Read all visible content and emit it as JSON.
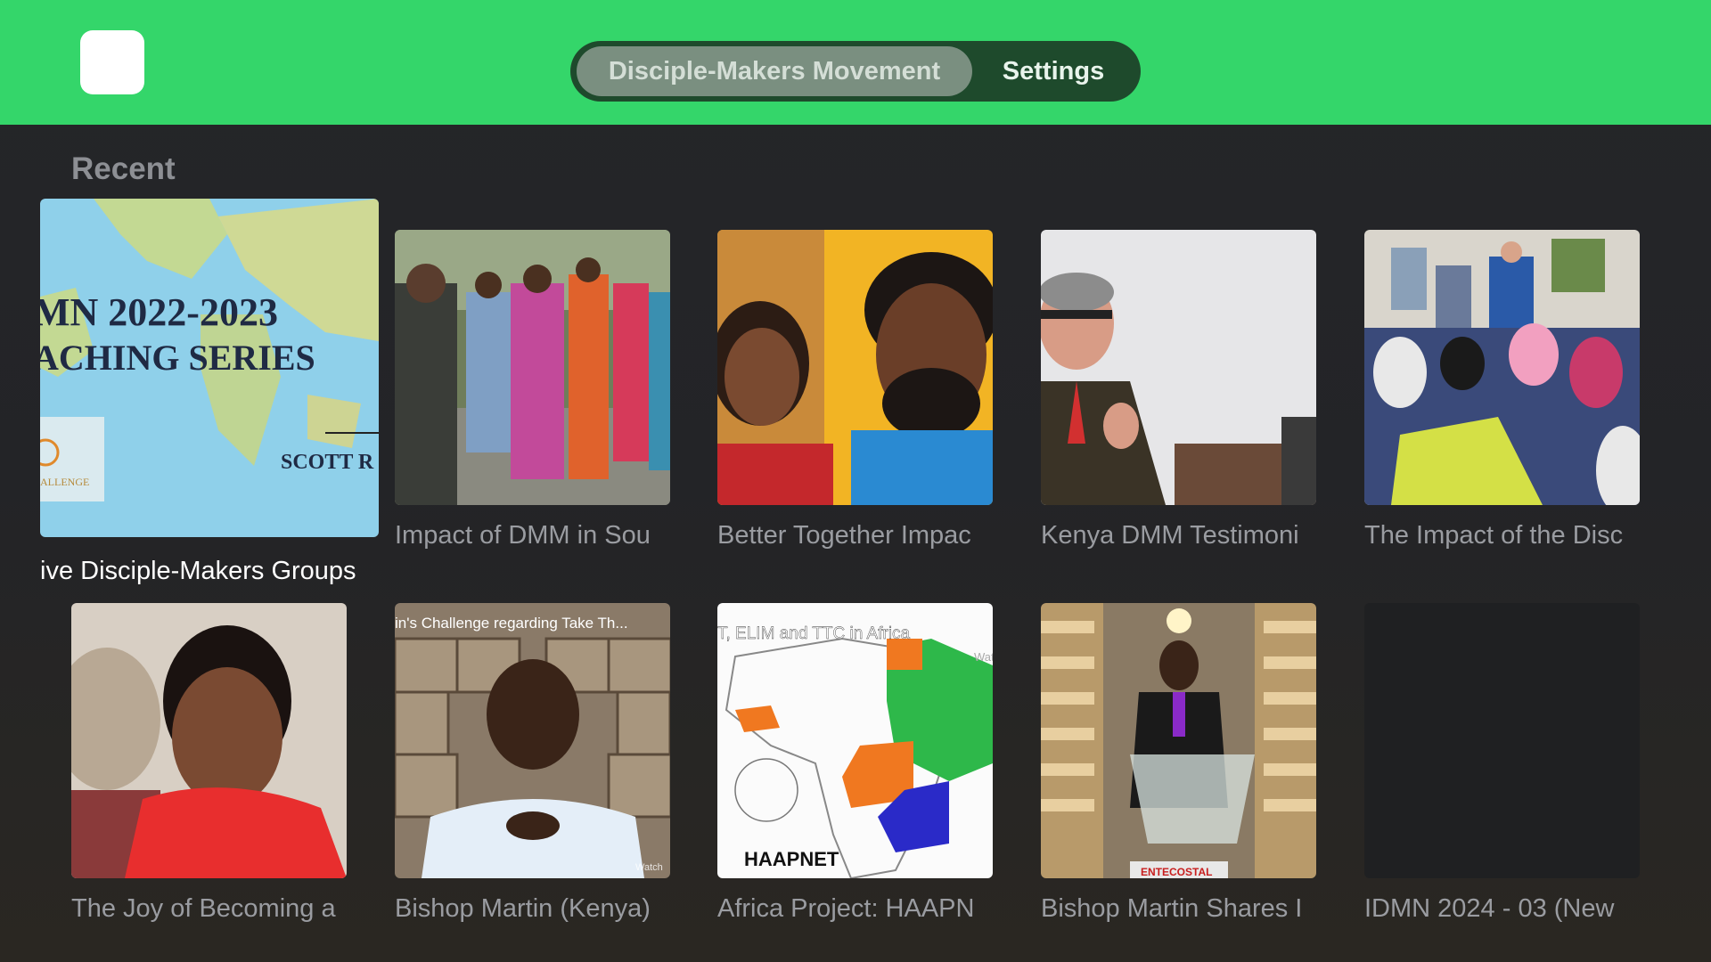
{
  "header": {
    "tabs": [
      {
        "label": "Disciple-Makers Movement",
        "selected": true
      },
      {
        "label": "Settings",
        "selected": false
      }
    ]
  },
  "section": {
    "title": "Recent"
  },
  "tiles": [
    {
      "caption": "ive Disciple-Makers Groups",
      "thumb": "map-teaching-series",
      "overlay_lines": [
        "MN 2022-2023",
        "ACHING SERIES",
        "SCOTT R",
        "ALLENGE"
      ]
    },
    {
      "caption": "Impact of DMM in Sou",
      "thumb": "women-dancing"
    },
    {
      "caption": "Better Together Impac",
      "thumb": "couple-video-call"
    },
    {
      "caption": "Kenya DMM Testimoni",
      "thumb": "speaker-glasses"
    },
    {
      "caption": "The Impact of the Disc",
      "thumb": "classroom-meeting"
    },
    {
      "caption": "The Joy of Becoming a",
      "thumb": "man-red-shirt"
    },
    {
      "caption": "Bishop Martin (Kenya)",
      "thumb": "man-stone-wall",
      "overlay_lines": [
        "in's Challenge regarding Take Th...",
        "Watch"
      ]
    },
    {
      "caption": "Africa Project: HAAPN",
      "thumb": "africa-map",
      "overlay_lines": [
        "T, ELIM and TTC in Africa",
        "HAAPNET",
        "Wat"
      ]
    },
    {
      "caption": "Bishop Martin Shares I",
      "thumb": "bishop-pulpit",
      "overlay_lines": [
        "ENTECOSTAL"
      ]
    },
    {
      "caption": "IDMN 2024 - 03 (New",
      "thumb": "blank"
    }
  ],
  "colors": {
    "topbar": "#34d66a",
    "tabbar": "#1e4a2c",
    "background": "#252629"
  }
}
